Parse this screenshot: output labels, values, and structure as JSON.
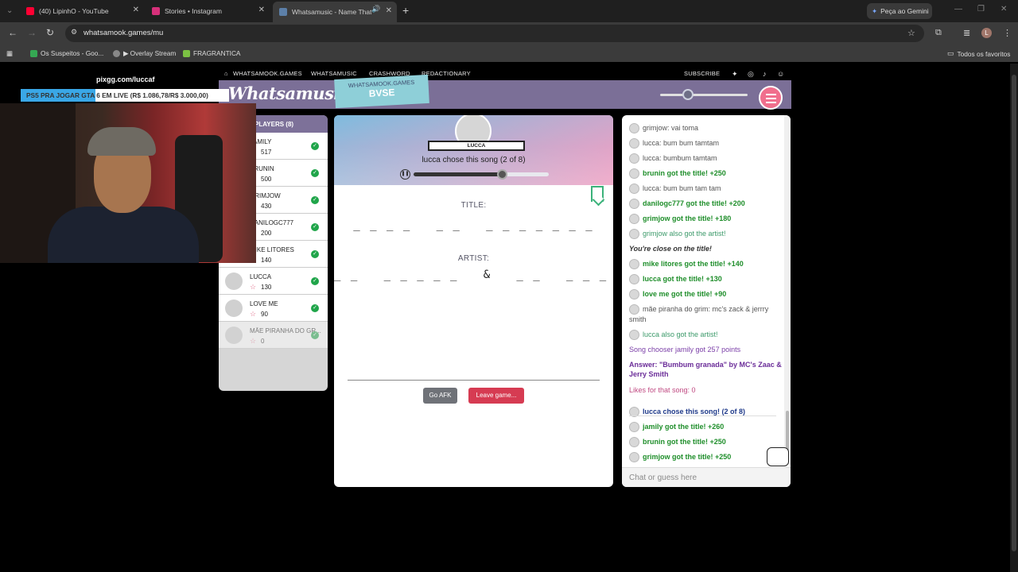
{
  "browser": {
    "tabs": [
      {
        "title": "(40) LipinhO - YouTube",
        "color": "#ff0033"
      },
      {
        "title": "Stories • Instagram",
        "color": "#d6307a"
      },
      {
        "title": "Whatsamusic - Name That",
        "color": "#5c7fa8"
      }
    ],
    "gemini_label": "Peça ao Gemini",
    "url": "whatsamook.games/mu",
    "bookmarks": [
      "Os Suspeitos - Goo...",
      "▶ Overlay Stream",
      "FRAGRANTICA"
    ],
    "favorites_label": "Todos os favoritos",
    "profile_initial": "L"
  },
  "stream": {
    "channel": "pixgg.com/luccaf",
    "banner": "PS5 PRA JOGAR GTA 6 EM LIVE (R$ 1.086,78/R$ 3.000,00)"
  },
  "site": {
    "nav": [
      "WHATSAMOOK.GAMES",
      "WHATSAMUSIC",
      "CRASHWORD",
      "REDACTIONARY"
    ],
    "subscribe": "SUBSCRIBE",
    "logo": "Whatsamusic",
    "room_site": "WHATSAMOOK.GAMES",
    "room_code": "BVSE"
  },
  "players": {
    "header": "PLAYERS (8)",
    "list": [
      {
        "name": "JAMILY",
        "score": "517",
        "done": true
      },
      {
        "name": "BRUNIN",
        "score": "500",
        "done": true
      },
      {
        "name": "GRIMJOW",
        "score": "430",
        "done": true
      },
      {
        "name": "DANILOGC777",
        "score": "200",
        "done": true
      },
      {
        "name": "MIKE LITORES",
        "score": "140",
        "done": true
      },
      {
        "name": "LUCCA",
        "score": "130",
        "done": true
      },
      {
        "name": "LOVE ME",
        "score": "90",
        "done": true
      },
      {
        "name": "MÃE PIRANHA DO GR...",
        "score": "0",
        "done": true
      }
    ]
  },
  "game": {
    "chooser": "LUCCA",
    "chose_text": "lucca chose this song (2 of 8)",
    "progress": 0.65,
    "title_label": "TITLE:",
    "title_blanks": "_ _ _ _   _ _   _ _ _ _ _ _ _",
    "artist_label": "ARTIST:",
    "artist_blanks": "_ _   _ _ _ _ _   &   _ _   _ _ _ _",
    "afk_button": "Go AFK",
    "leave_button": "Leave game..."
  },
  "chat": {
    "messages": [
      {
        "text": "grimjow: vai toma",
        "style": "plain",
        "avatar": true
      },
      {
        "text": "lucca: bum bum tamtam",
        "style": "plain",
        "avatar": true
      },
      {
        "text": "lucca: bumbum tamtam",
        "style": "plain",
        "avatar": true
      },
      {
        "text": "brunin got the title! +250",
        "style": "green",
        "avatar": true
      },
      {
        "text": "lucca: bum bum tam tam",
        "style": "plain",
        "avatar": true
      },
      {
        "text": "danilogc777 got the title! +200",
        "style": "green",
        "avatar": true
      },
      {
        "text": "grimjow got the title! +180",
        "style": "green",
        "avatar": true
      },
      {
        "text": "grimjow also got the artist!",
        "style": "green2",
        "avatar": true
      },
      {
        "text": "You're close on the title!",
        "style": "dark",
        "avatar": false
      },
      {
        "text": "mike litores got the title! +140",
        "style": "green",
        "avatar": true
      },
      {
        "text": "lucca got the title! +130",
        "style": "green",
        "avatar": true
      },
      {
        "text": "love me got the title! +90",
        "style": "green",
        "avatar": true
      },
      {
        "text": "mãe piranha do grim: mc's zack & jerrry smith",
        "style": "plain",
        "avatar": true
      },
      {
        "text": "lucca also got the artist!",
        "style": "green2",
        "avatar": true
      },
      {
        "text": "Song chooser jamily got 257 points",
        "style": "purple",
        "avatar": false
      },
      {
        "text": "Answer: \"Bumbum granada\" by MC's Zaac & Jerry Smith",
        "style": "purpleb",
        "avatar": false
      },
      {
        "text": "Likes for that song: 0",
        "style": "pink",
        "avatar": false
      },
      {
        "text": "lucca chose this song! (2 of 8)",
        "style": "blue",
        "avatar": true
      },
      {
        "text": "jamily got the title! +260",
        "style": "green",
        "avatar": true
      },
      {
        "text": "brunin got the title! +250",
        "style": "green",
        "avatar": true
      },
      {
        "text": "grimjow got the title! +250",
        "style": "green",
        "avatar": true
      }
    ],
    "placeholder": "Chat or guess here"
  }
}
